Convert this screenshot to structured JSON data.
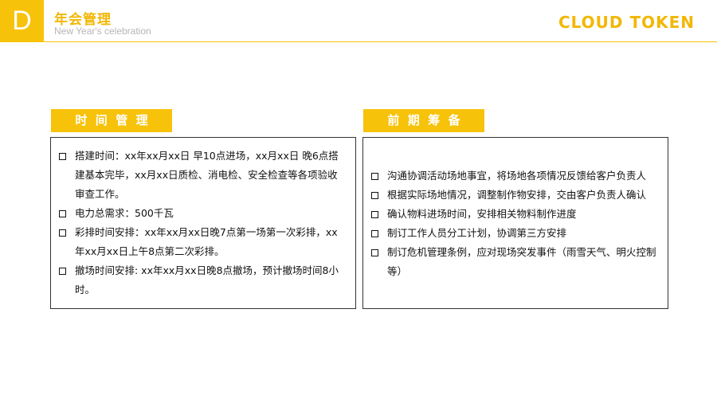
{
  "header": {
    "badge": "D",
    "title": "年会管理",
    "subtitle": "New Year's celebration",
    "brand": "CLOUD TOKEN"
  },
  "left": {
    "tag": "时  间  管  理",
    "items": [
      "搭建时间：xx年xx月xx日 早10点进场，xx月xx日 晚6点搭建基本完毕，xx月xx日质检、消电检、安全检查等各项验收审查工作。",
      "电力总需求：500千瓦",
      "彩排时间安排：xx年xx月xx日晚7点第一场第一次彩排，xx年xx月xx日上午8点第二次彩排。",
      "撤场时间安排: xx年xx月xx日晚8点撤场，预计撤场时间8小时。"
    ]
  },
  "right": {
    "tag": "前  期  筹  备",
    "items": [
      "沟通协调活动场地事宜，将场地各项情况反馈给客户负责人",
      "根据实际场地情况，调整制作物安排，交由客户负责人确认",
      "确认物料进场时间，安排相关物料制作进度",
      "制订工作人员分工计划，协调第三方安排",
      "制订危机管理条例，应对现场突发事件（雨雪天气、明火控制等）"
    ]
  },
  "colors": {
    "accent": "#f7c20a",
    "brand": "#f2b705"
  }
}
